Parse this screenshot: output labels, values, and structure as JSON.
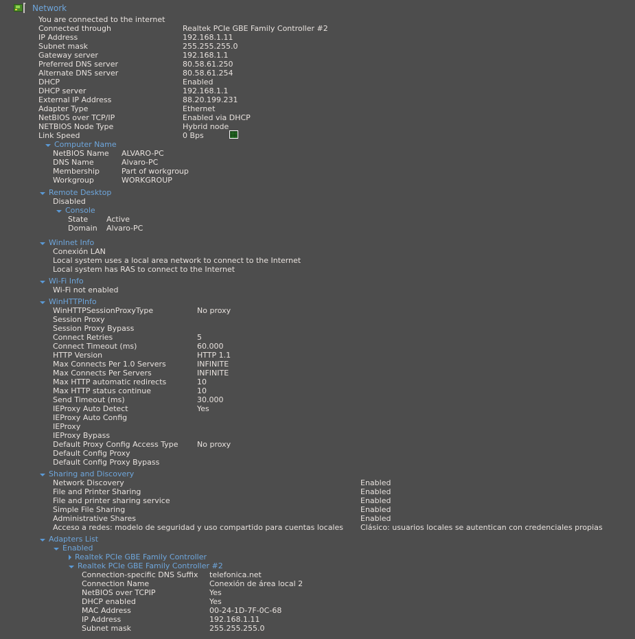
{
  "header": {
    "title": "Network",
    "icon": "network-card-icon"
  },
  "colors": {
    "background": "#4d4d4d",
    "text": "#e8e2de",
    "section_header": "#6ea6dc",
    "caret": "#5b9ad6",
    "spark_green": "#46e046"
  },
  "summary": {
    "status": "You are connected to the internet",
    "rows": [
      {
        "label": "Connected through",
        "value": "Realtek PCIe GBE Family Controller #2"
      },
      {
        "label": "IP Address",
        "value": "192.168.1.11"
      },
      {
        "label": "Subnet mask",
        "value": "255.255.255.0"
      },
      {
        "label": "Gateway server",
        "value": "192.168.1.1"
      },
      {
        "label": "Preferred DNS server",
        "value": "80.58.61.250"
      },
      {
        "label": "Alternate DNS server",
        "value": "80.58.61.254"
      },
      {
        "label": "DHCP",
        "value": "Enabled"
      },
      {
        "label": "DHCP server",
        "value": "192.168.1.1"
      },
      {
        "label": "External IP Address",
        "value": "88.20.199.231"
      },
      {
        "label": "Adapter Type",
        "value": "Ethernet"
      },
      {
        "label": "NetBIOS over TCP/IP",
        "value": "Enabled via DHCP"
      },
      {
        "label": "NETBIOS Node Type",
        "value": "Hybrid node"
      },
      {
        "label": "Link Speed",
        "value": "0 Bps"
      }
    ]
  },
  "computer_name": {
    "title": "Computer Name",
    "expanded": true,
    "rows": [
      {
        "label": "NetBIOS Name",
        "value": "ALVARO-PC"
      },
      {
        "label": "DNS Name",
        "value": "Alvaro-PC"
      },
      {
        "label": "Membership",
        "value": "Part of workgroup"
      },
      {
        "label": "Workgroup",
        "value": "WORKGROUP"
      }
    ]
  },
  "remote_desktop": {
    "title": "Remote Desktop",
    "expanded": true,
    "status": "Disabled",
    "console": {
      "title": "Console",
      "expanded": true,
      "rows": [
        {
          "label": "State",
          "value": "Active"
        },
        {
          "label": "Domain",
          "value": "Alvaro-PC"
        }
      ]
    }
  },
  "wininet": {
    "title": "WinInet Info",
    "expanded": true,
    "lines": [
      "Conexión LAN",
      "Local system uses a local area network to connect to the Internet",
      "Local system has RAS to connect to the Internet"
    ]
  },
  "wifi": {
    "title": "Wi-Fi Info",
    "expanded": true,
    "lines": [
      "Wi-Fi not enabled"
    ]
  },
  "winhttp": {
    "title": "WinHTTPInfo",
    "expanded": true,
    "rows": [
      {
        "label": "WinHTTPSessionProxyType",
        "value": "No proxy"
      },
      {
        "label": "Session Proxy",
        "value": ""
      },
      {
        "label": "Session Proxy Bypass",
        "value": ""
      },
      {
        "label": "Connect Retries",
        "value": "5"
      },
      {
        "label": "Connect Timeout (ms)",
        "value": "60.000"
      },
      {
        "label": "HTTP Version",
        "value": "HTTP 1.1"
      },
      {
        "label": "Max Connects Per 1.0 Servers",
        "value": "INFINITE"
      },
      {
        "label": "Max Connects Per Servers",
        "value": "INFINITE"
      },
      {
        "label": "Max HTTP automatic redirects",
        "value": "10"
      },
      {
        "label": "Max HTTP status continue",
        "value": "10"
      },
      {
        "label": "Send Timeout (ms)",
        "value": "30.000"
      },
      {
        "label": "IEProxy Auto Detect",
        "value": "Yes"
      },
      {
        "label": "IEProxy Auto Config",
        "value": ""
      },
      {
        "label": "IEProxy",
        "value": ""
      },
      {
        "label": "IEProxy Bypass",
        "value": ""
      },
      {
        "label": "Default Proxy Config Access Type",
        "value": "No proxy"
      },
      {
        "label": "Default Config Proxy",
        "value": ""
      },
      {
        "label": "Default Config Proxy Bypass",
        "value": ""
      }
    ]
  },
  "sharing": {
    "title": "Sharing and Discovery",
    "expanded": true,
    "rows": [
      {
        "label": "Network Discovery",
        "value": "Enabled"
      },
      {
        "label": "File and Printer Sharing",
        "value": "Enabled"
      },
      {
        "label": "File and printer sharing service",
        "value": "Enabled"
      },
      {
        "label": "Simple File Sharing",
        "value": "Enabled"
      },
      {
        "label": "Administrative Shares",
        "value": "Enabled"
      },
      {
        "label": "Acceso a redes: modelo de seguridad y uso compartido para cuentas locales",
        "value": "Clásico: usuarios locales se autentican con credenciales propias"
      }
    ]
  },
  "adapters": {
    "title": "Adapters List",
    "expanded": true,
    "enabled_group": {
      "title": "Enabled",
      "expanded": true,
      "adapter_collapsed": {
        "title": "Realtek PCIe GBE Family Controller",
        "expanded": false
      },
      "adapter_expanded": {
        "title": "Realtek PCIe GBE Family Controller #2",
        "expanded": true,
        "rows": [
          {
            "label": "Connection-specific DNS Suffix",
            "value": "telefonica.net"
          },
          {
            "label": "Connection Name",
            "value": "Conexión de área local 2"
          },
          {
            "label": "NetBIOS over TCPIP",
            "value": "Yes"
          },
          {
            "label": "DHCP enabled",
            "value": "Yes"
          },
          {
            "label": "MAC Address",
            "value": "00-24-1D-7F-0C-68"
          },
          {
            "label": "IP Address",
            "value": "192.168.1.11"
          },
          {
            "label": "Subnet mask",
            "value": "255.255.255.0"
          }
        ]
      }
    }
  }
}
